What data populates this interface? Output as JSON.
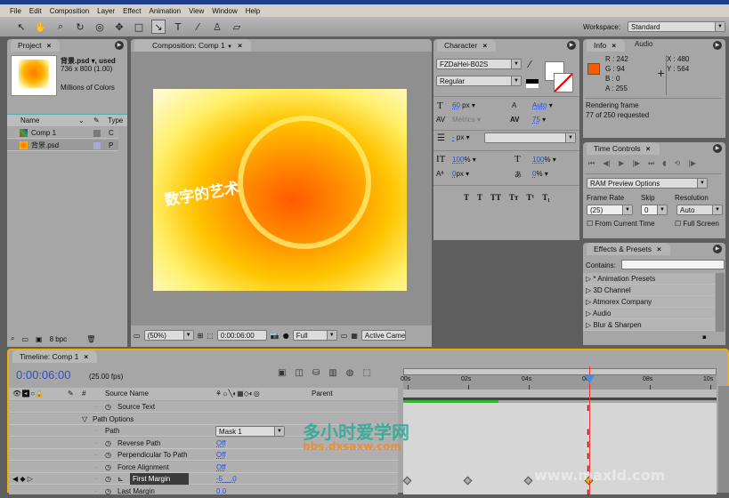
{
  "menu": [
    "File",
    "Edit",
    "Composition",
    "Layer",
    "Effect",
    "Animation",
    "View",
    "Window",
    "Help"
  ],
  "toolbar": {
    "icons": [
      "selection-tool-icon",
      "hand-tool-icon",
      "zoom-tool-icon",
      "rotate-tool-icon",
      "orbit-camera-icon",
      "track-camera-icon",
      "rectangle-mask-icon",
      "pen-tool-icon",
      "text-tool-icon",
      "brush-tool-icon",
      "clone-stamp-icon",
      "eraser-icon"
    ],
    "workspace_label": "Workspace:",
    "workspace_value": "Standard"
  },
  "project": {
    "tab": "Project",
    "item_name": "背景.psd ▾, used",
    "dimensions": "736 x 800 (1.00)",
    "colors": "Millions of Colors",
    "columns": [
      "Name",
      "Type"
    ],
    "items": [
      {
        "name": "Comp 1",
        "type": "C",
        "color": "#7a7a7a"
      },
      {
        "name": "背景.psd",
        "type": "P",
        "color": "#a8a8d0"
      }
    ],
    "bpc": "8 bpc"
  },
  "composition": {
    "tab": "Composition: Comp 1",
    "canvas_text": "数字的艺术",
    "zoom": "(50%)",
    "timecode": "0:00:06:00",
    "resolution": "Full",
    "camera": "Active Camera"
  },
  "character": {
    "tab": "Character",
    "font": "FZDaHei-B02S",
    "style": "Regular",
    "size": "60",
    "size_unit": "px",
    "leading": "Auto",
    "kerning": "Metrics",
    "tracking": "75",
    "stroke": "-",
    "stroke_unit": "px",
    "vscale": "100",
    "hscale": "100",
    "pct": "%",
    "baseline": "0",
    "baseline_unit": "px",
    "tsume": "0",
    "styles": [
      "T",
      "T",
      "TT",
      "Tт",
      "T¹",
      "T₁"
    ]
  },
  "info": {
    "tab": "Info",
    "tab2": "Audio",
    "r": "R : 242",
    "g": "G : 94",
    "b": "B : 0",
    "a": "A : 255",
    "x": "X : 480",
    "y": "Y : 564",
    "swatch": "#f25e00",
    "status1": "Rendering frame",
    "status2": "77 of 250 requested"
  },
  "time_controls": {
    "tab": "Time Controls",
    "ram_preview": "RAM Preview Options",
    "frame_rate_label": "Frame Rate",
    "frame_rate": "(25)",
    "skip_label": "Skip",
    "skip": "0",
    "resolution_label": "Resolution",
    "resolution": "Auto",
    "from_current": "From Current Time",
    "full_screen": "Full Screen"
  },
  "effects": {
    "tab": "Effects & Presets",
    "contains_label": "Contains:",
    "contains_value": "",
    "items": [
      "* Animation Presets",
      "3D Channel",
      "Atmorex Company",
      "Audio",
      "Blur & Sharpen"
    ]
  },
  "timeline": {
    "tab": "Timeline: Comp 1",
    "timecode": "0:00:06:00",
    "fps": "(25.00 fps)",
    "col_source": "Source Name",
    "col_parent": "Parent",
    "ruler": [
      "00s",
      "02s",
      "04s",
      "06s",
      "08s",
      "10s"
    ],
    "playhead_seconds": 6,
    "work_area_end_seconds": 10,
    "rendered_seconds": 3,
    "rows": [
      {
        "name": "Source Text",
        "indent": 3,
        "stopwatch": true
      },
      {
        "name": "Path Options",
        "indent": 2,
        "twirl": true
      },
      {
        "name": "Path",
        "indent": 3,
        "value": "Mask 1",
        "dropdown": true
      },
      {
        "name": "Reverse Path",
        "indent": 3,
        "stopwatch": true,
        "value": "Off"
      },
      {
        "name": "Perpendicular To Path",
        "indent": 3,
        "stopwatch": true,
        "value": "Off"
      },
      {
        "name": "Force Alignment",
        "indent": 3,
        "stopwatch": true,
        "value": "Off"
      },
      {
        "name": "First Margin",
        "indent": 3,
        "stopwatch": true,
        "value": "-5__.0",
        "selected": true,
        "keyframes": [
          0,
          2,
          4,
          6
        ]
      },
      {
        "name": "Last Margin",
        "indent": 3,
        "stopwatch": true,
        "value": "0.0"
      }
    ]
  },
  "watermarks": [
    "多小时爱学网",
    "bbs.dxsaxw.com",
    "www.maxld.com"
  ]
}
